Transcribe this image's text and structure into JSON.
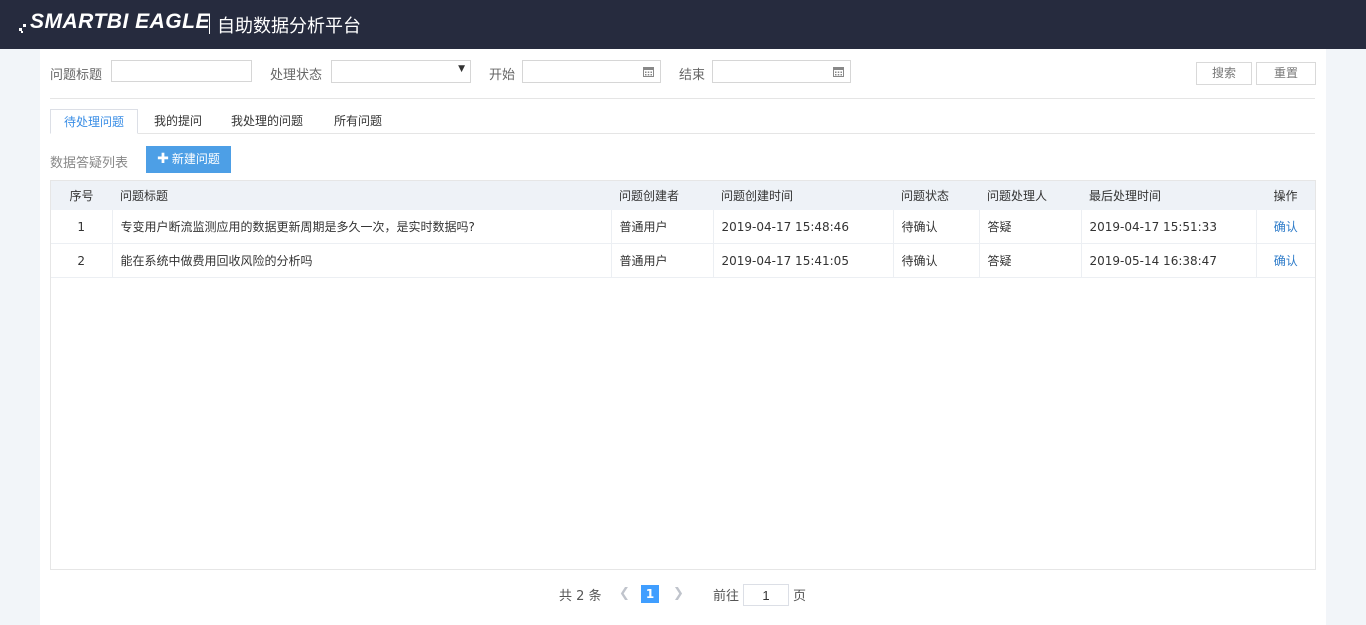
{
  "header": {
    "logo_text": "SMARTBI EAGLE",
    "app_title": "自助数据分析平台"
  },
  "filters": {
    "title_label": "问题标题",
    "title_value": "",
    "status_label": "处理状态",
    "status_value": "",
    "start_label": "开始",
    "start_value": "",
    "end_label": "结束",
    "end_value": "",
    "search_button": "搜索",
    "reset_button": "重置"
  },
  "tabs": [
    {
      "label": "待处理问题",
      "active": true
    },
    {
      "label": "我的提问",
      "active": false
    },
    {
      "label": "我处理的问题",
      "active": false
    },
    {
      "label": "所有问题",
      "active": false
    }
  ],
  "list": {
    "label": "数据答疑列表",
    "new_button": "新建问题",
    "columns": [
      "序号",
      "问题标题",
      "问题创建者",
      "问题创建时间",
      "问题状态",
      "问题处理人",
      "最后处理时间",
      "操作"
    ],
    "rows": [
      {
        "index": "1",
        "title": "专变用户断流监测应用的数据更新周期是多久一次，是实时数据吗?",
        "creator": "普通用户",
        "created_at": "2019-04-17 15:48:46",
        "status": "待确认",
        "handler": "答疑",
        "last_time": "2019-04-17 15:51:33",
        "action": "确认"
      },
      {
        "index": "2",
        "title": "能在系统中做费用回收风险的分析吗",
        "creator": "普通用户",
        "created_at": "2019-04-17 15:41:05",
        "status": "待确认",
        "handler": "答疑",
        "last_time": "2019-05-14 16:38:47",
        "action": "确认"
      }
    ]
  },
  "pagination": {
    "total_text": "共 2 条",
    "current_page": "1",
    "goto_label": "前往",
    "goto_value": "1",
    "page_suffix": "页"
  },
  "colors": {
    "topbar": "#262b3e",
    "accent": "#409eff",
    "new_button": "#4d9fe6",
    "link": "#2d7bc9"
  }
}
